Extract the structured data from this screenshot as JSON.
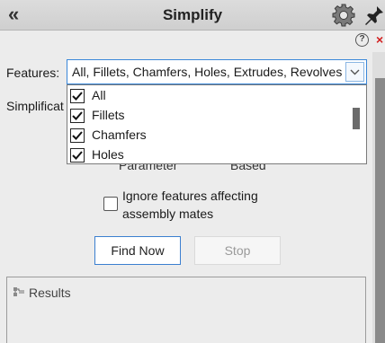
{
  "header": {
    "title": "Simplify",
    "collapse_glyph": "«",
    "gear_icon": "gear-icon",
    "pin_icon": "pin-icon"
  },
  "helpbar": {
    "help_glyph": "?",
    "close_glyph": "×"
  },
  "features": {
    "label": "Features:",
    "value": "All, Fillets, Chamfers, Holes, Extrudes, Revolves",
    "options": [
      {
        "label": "All",
        "checked": true
      },
      {
        "label": "Fillets",
        "checked": true
      },
      {
        "label": "Chamfers",
        "checked": true
      },
      {
        "label": "Holes",
        "checked": true
      }
    ]
  },
  "simplification": {
    "label_partial": "Simplificat",
    "option_parameter_partial": "Parameter",
    "option_based_partial": "Based"
  },
  "ignore_mates": {
    "line1": "Ignore features affecting",
    "line2": "assembly mates",
    "checked": false
  },
  "buttons": {
    "find_now": "Find Now",
    "stop": "Stop"
  },
  "results": {
    "label": "Results"
  },
  "colors": {
    "accent": "#3b7fd0",
    "close": "#d21e1e"
  }
}
